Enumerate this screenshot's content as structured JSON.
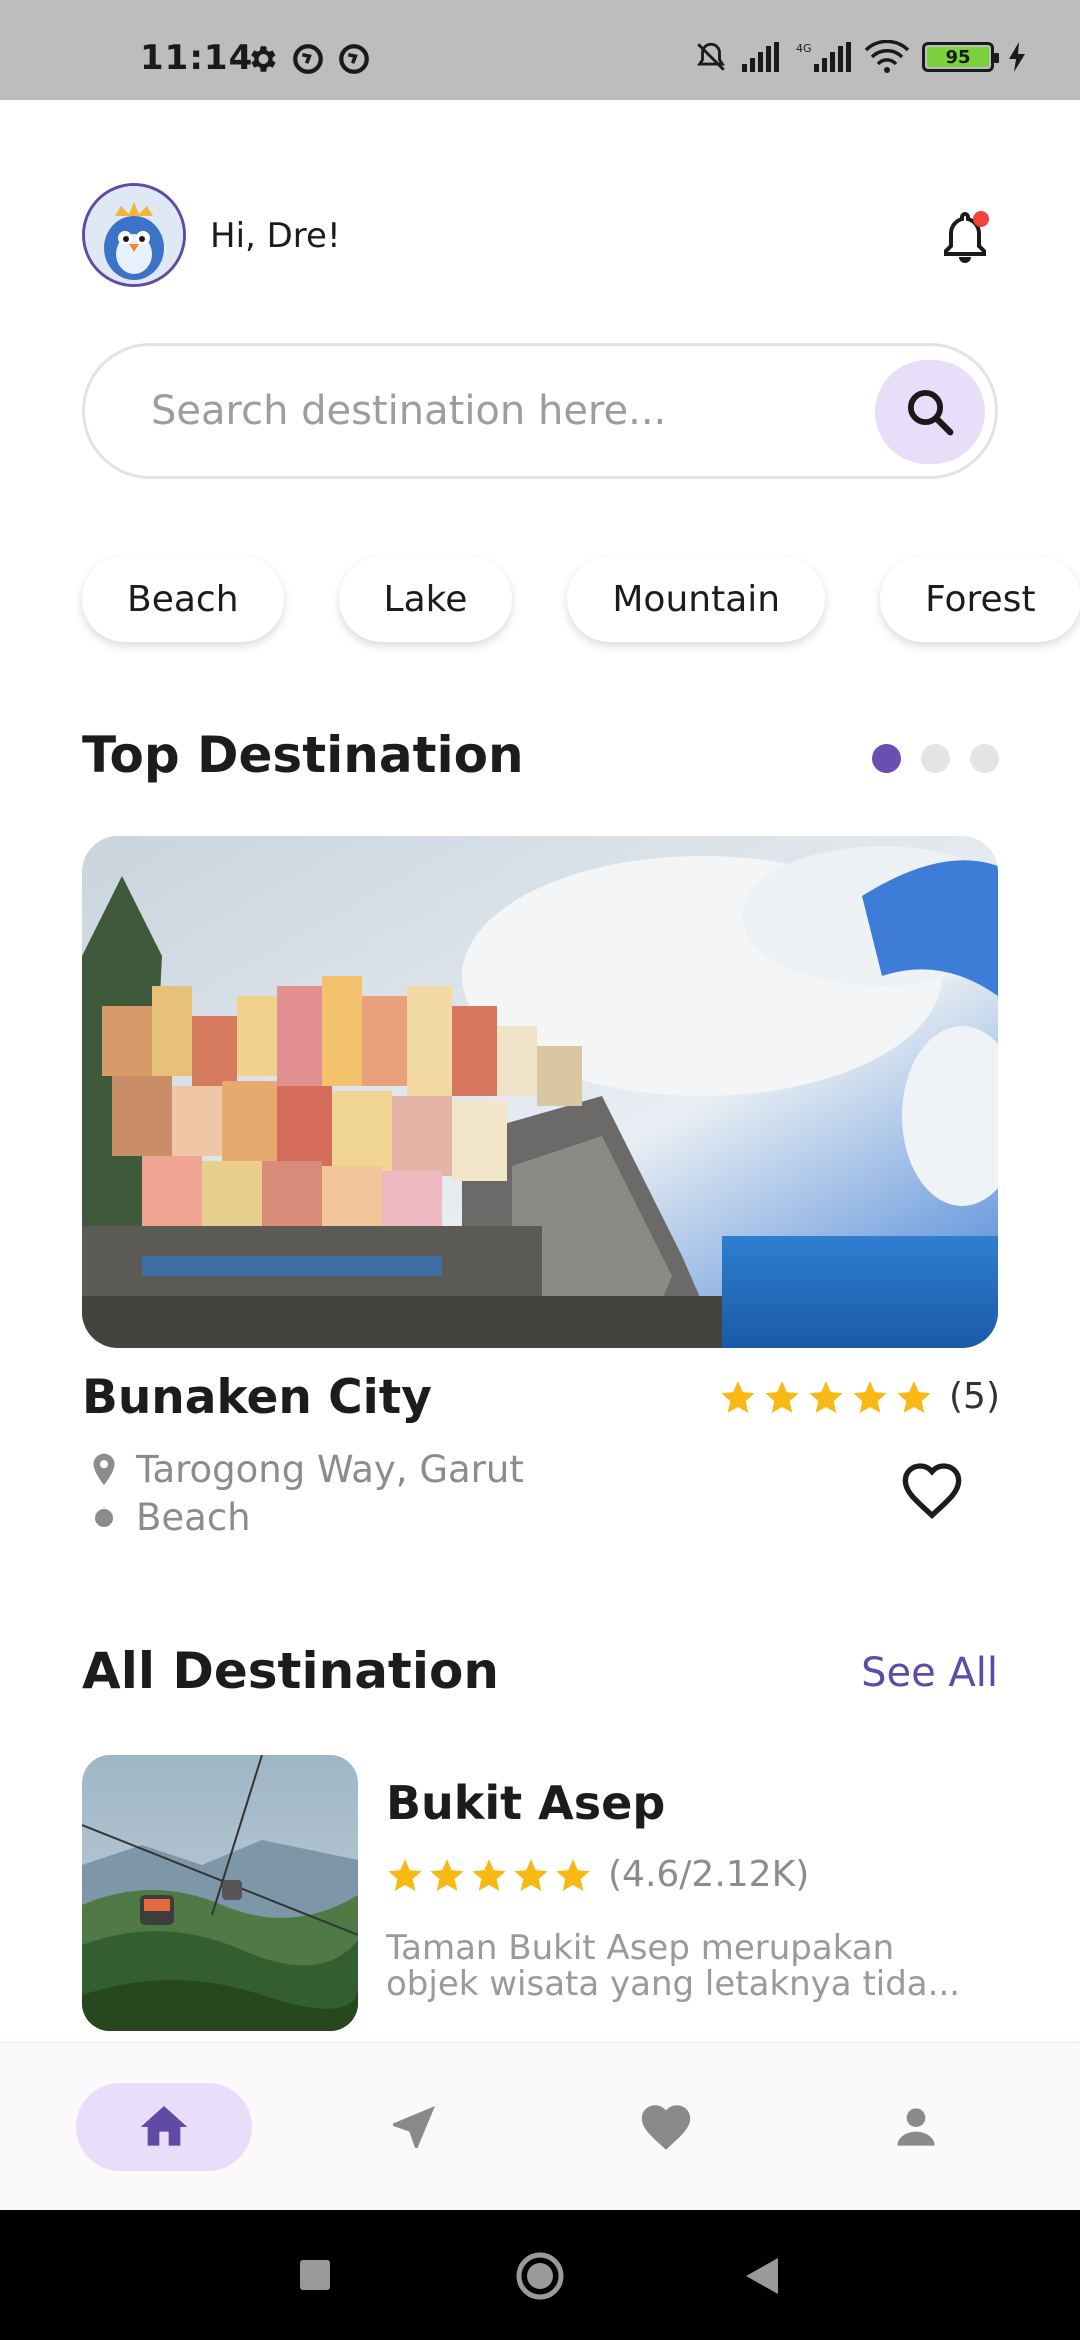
{
  "status_bar": {
    "time": "11:14",
    "battery": "95",
    "network": "4G",
    "icons": [
      "settings-icon",
      "sync-icon",
      "sync-icon",
      "mute-icon",
      "signal-icon",
      "signal-4g-icon",
      "wifi-icon",
      "battery-icon",
      "charging-icon"
    ]
  },
  "header": {
    "greeting": "Hi, Dre!",
    "avatar_icon": "avatar",
    "notification_icon": "bell-icon",
    "has_unread": true
  },
  "search": {
    "placeholder": "Search destination here...",
    "value": "",
    "button_icon": "search-icon"
  },
  "categories": [
    "Beach",
    "Lake",
    "Mountain",
    "Forest"
  ],
  "top_destination": {
    "section_title": "Top Destination",
    "carousel_pages": 3,
    "carousel_active": 0,
    "name": "Bunaken City",
    "stars": 5,
    "rating_count": "(5)",
    "location": "Tarogong Way, Garut",
    "category": "Beach"
  },
  "all_destination": {
    "section_title": "All Destination",
    "see_all": "See All",
    "items": [
      {
        "title": "Bukit Asep",
        "stars": 5,
        "rating": "(4.6/2.12K)",
        "description": "Taman Bukit Asep merupakan objek wisata yang letaknya tida..."
      }
    ]
  },
  "bottom_nav": {
    "items": [
      "home-icon",
      "navigation-icon",
      "favorite-icon",
      "profile-icon"
    ],
    "active": 0
  },
  "colors": {
    "accent": "#5e4ba6",
    "accent_light": "#e9def9",
    "star": "#f9b915",
    "notification_dot": "#f04438"
  }
}
